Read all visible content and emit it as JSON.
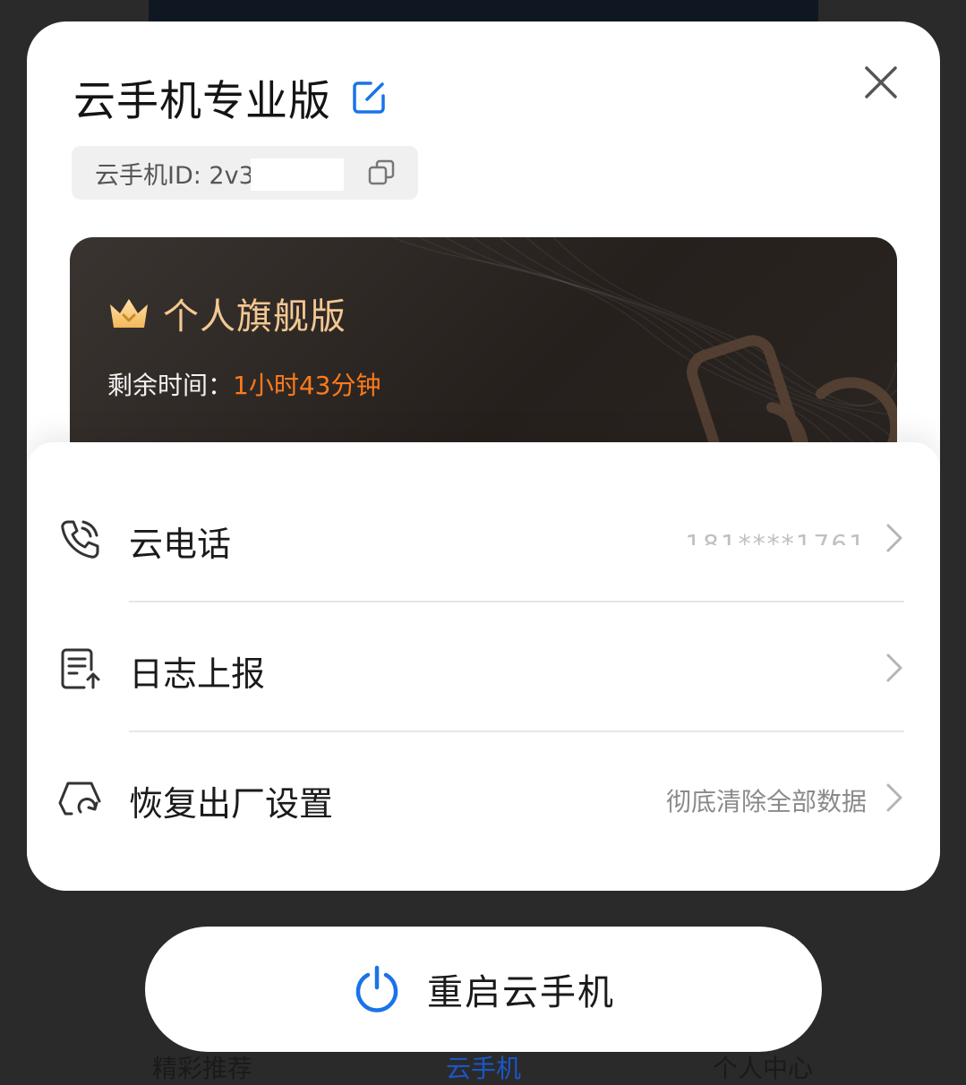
{
  "background": {
    "tabs": [
      "精彩推荐",
      "云手机",
      "个人中心"
    ]
  },
  "sheet": {
    "title": "云手机专业版",
    "id_label": "云手机ID: 2v3",
    "plan": {
      "name": "个人旗舰版",
      "remaining_label": "剩余时间：",
      "remaining_value": "1小时43分钟"
    },
    "menu": [
      {
        "label": "云电话",
        "value": "181****1761",
        "icon": "phone-icon"
      },
      {
        "label": "日志上报",
        "value": "",
        "icon": "log-upload-icon"
      },
      {
        "label": "恢复出厂设置",
        "value": "彻底清除全部数据",
        "icon": "factory-reset-icon"
      }
    ]
  },
  "restart_button": {
    "label": "重启云手机",
    "icon": "power-icon"
  },
  "colors": {
    "accent_blue": "#1a73e8",
    "plan_gold": "#f3c892",
    "remaining_orange": "#ff7a1a"
  }
}
